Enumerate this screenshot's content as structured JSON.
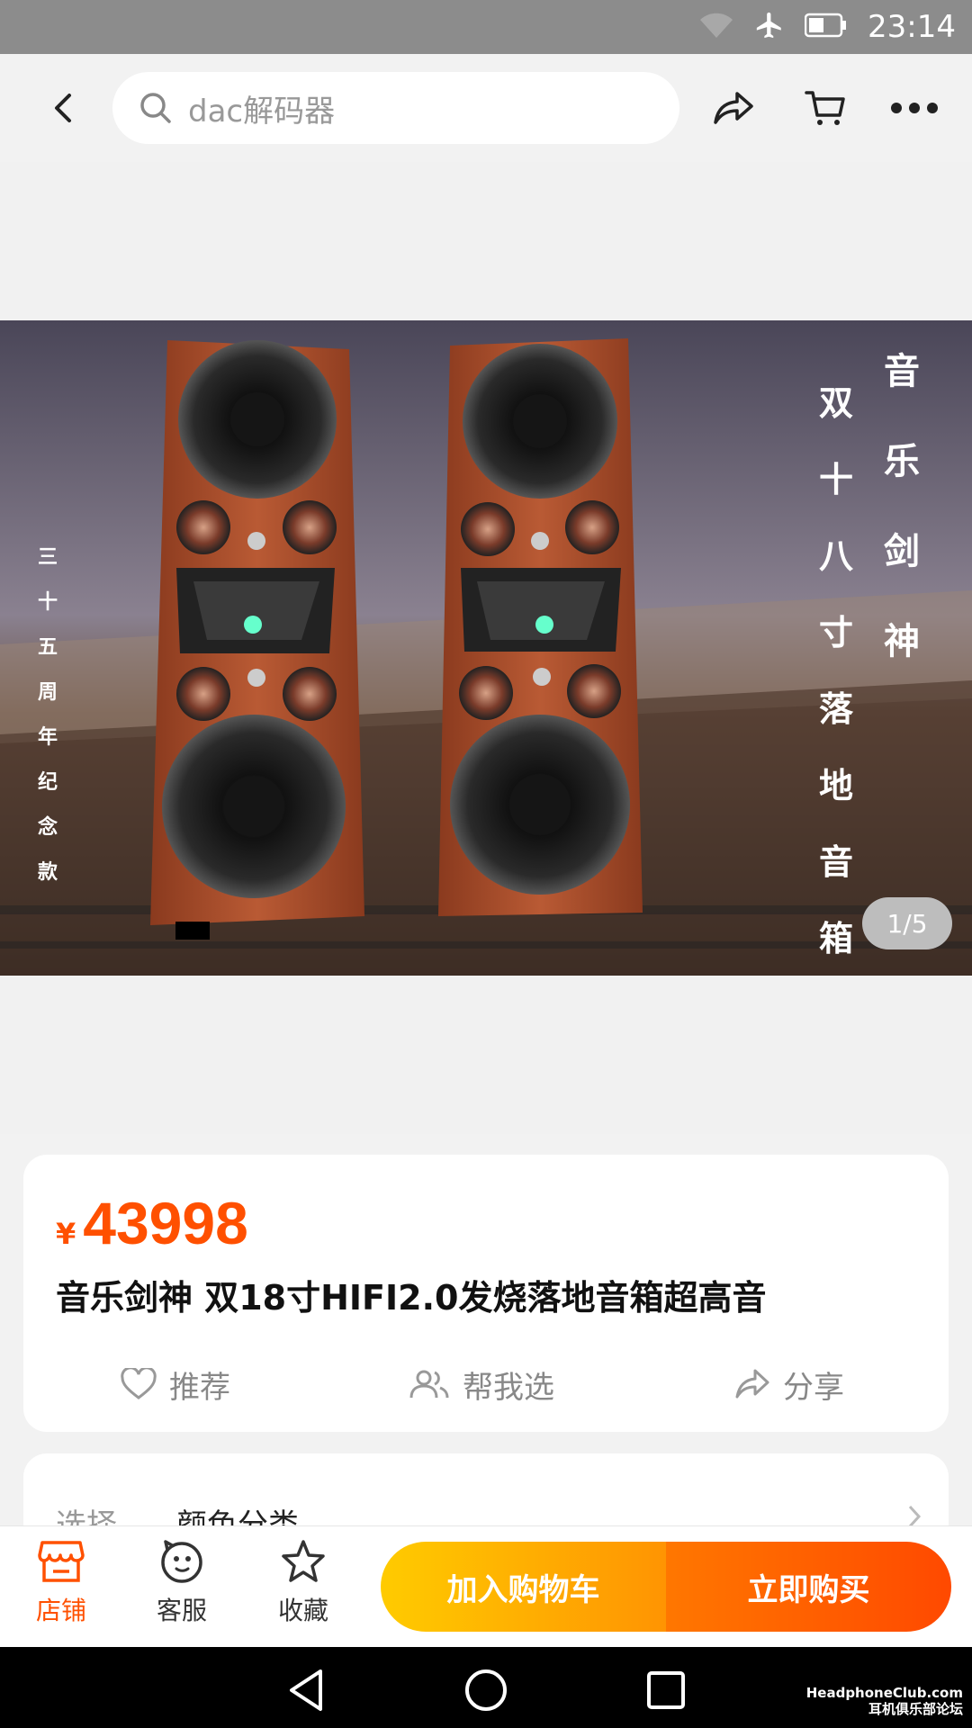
{
  "status_bar": {
    "time": "23:14"
  },
  "search": {
    "placeholder": "dac解码器"
  },
  "gallery": {
    "counter": "1/5",
    "overlay_text_left": [
      "三",
      "十",
      "五",
      "周",
      "年",
      "纪",
      "念",
      "款"
    ],
    "overlay_text_right_col1": [
      "双",
      "十",
      "八",
      "寸",
      "落",
      "地",
      "音",
      "箱"
    ],
    "overlay_text_right_col2": [
      "音",
      "乐",
      "剑",
      "神"
    ]
  },
  "product": {
    "currency": "¥",
    "price": "43998",
    "title": "音乐剑神 双18寸HIFI2.0发烧落地音箱超高音"
  },
  "actions": {
    "recommend": "推荐",
    "help_choose": "帮我选",
    "share": "分享"
  },
  "options": {
    "label": "选择",
    "value": "颜色分类"
  },
  "bottom_bar": {
    "shop": "店铺",
    "service": "客服",
    "favorite": "收藏",
    "add_cart": "加入购物车",
    "buy_now": "立即购买"
  },
  "watermark": {
    "line1": "HeadphoneClub.com",
    "line2": "耳机俱乐部论坛"
  },
  "colors": {
    "accent": "#ff5000",
    "cart_start": "#ffcb00",
    "buy_end": "#ff4900"
  }
}
